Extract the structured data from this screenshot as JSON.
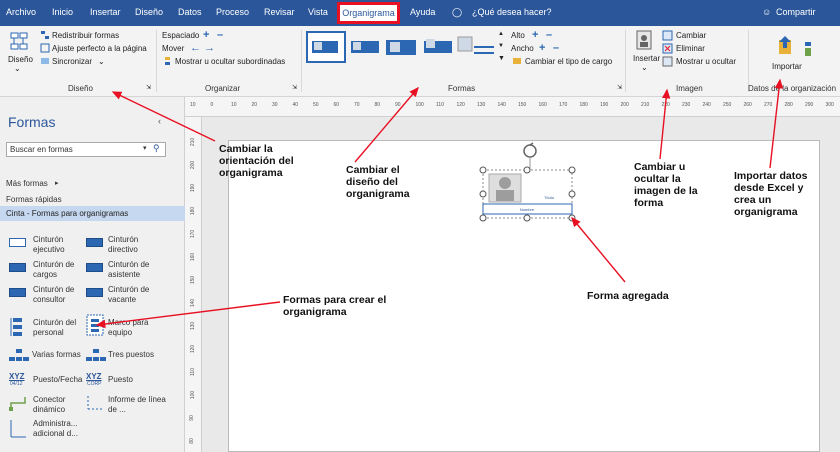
{
  "menu": {
    "items": [
      "Archivo",
      "Inicio",
      "Insertar",
      "Diseño",
      "Datos",
      "Proceso",
      "Revisar",
      "Vista"
    ],
    "active": "Organigrama",
    "help": "Ayuda",
    "tell_me": "¿Qué desea hacer?",
    "share": "Compartir"
  },
  "ribbon": {
    "diseno": {
      "big_label": "Diseño",
      "redistribuir": "Redistribuir formas",
      "ajuste": "Ajuste perfecto a la página",
      "sincronizar": "Sincronizar",
      "group": "Diseño"
    },
    "organizar": {
      "espaciado": "Espaciado",
      "mover": "Mover",
      "mostrar_ocultar": "Mostrar u ocultar subordinadas",
      "group": "Organizar"
    },
    "formas": {
      "alto": "Alto",
      "ancho": "Ancho",
      "cambiar_tipo": "Cambiar el tipo de cargo",
      "group": "Formas"
    },
    "imagen": {
      "insertar": "Insertar",
      "cambiar": "Cambiar",
      "eliminar": "Eliminar",
      "mostrar_ocultar": "Mostrar u ocultar",
      "group": "Imagen"
    },
    "datos": {
      "importar": "Importar",
      "group": "Datos de la organización"
    }
  },
  "shapes_panel": {
    "title": "Formas",
    "search_placeholder": "Buscar en formas",
    "mas_formas": "Más formas",
    "formas_rapidas": "Formas rápidas",
    "stencil": "Cinta - Formas para organigramas",
    "items": [
      [
        "Cinturón ejecutivo",
        "Cinturón directivo"
      ],
      [
        "Cinturón de cargos",
        "Cinturón de asistente"
      ],
      [
        "Cinturón de consultor",
        "Cinturón de vacante"
      ],
      [
        "Cinturón del personal",
        "Marco para equipo"
      ],
      [
        "Varias formas",
        "Tres puestos"
      ],
      [
        "Puesto/Fecha",
        "Puesto"
      ],
      [
        "Conector dinámico",
        "Informe de línea de ..."
      ],
      [
        "Administra... adicional d...",
        ""
      ]
    ],
    "xyz_badge": "XYZ",
    "xyz_sub_1": "04/12",
    "xyz_sub_2": "CORP"
  },
  "ruler": {
    "h_ticks": [
      "10",
      "0",
      "10",
      "20",
      "30",
      "40",
      "50",
      "60",
      "70",
      "80",
      "90",
      "100",
      "110",
      "120",
      "130",
      "140",
      "150",
      "160",
      "170",
      "180",
      "190",
      "200",
      "210",
      "220",
      "230",
      "240",
      "250",
      "260",
      "270",
      "280",
      "290",
      "300"
    ],
    "v_ticks": [
      "210",
      "200",
      "190",
      "180",
      "170",
      "160",
      "150",
      "140",
      "130",
      "120",
      "110",
      "100",
      "90",
      "80"
    ]
  },
  "org_shape": {
    "title": "Título",
    "name": "Nombre"
  },
  "annotations": {
    "orientacion": "Cambiar la orientación del organigrama",
    "diseno": "Cambiar el diseño del organigrama",
    "imagen": "Cambiar u ocultar la imagen de la forma",
    "importar": "Importar datos desde Excel y crea un organigrama",
    "formas_crear": "Formas para crear el organigrama",
    "forma_agregada": "Forma agregada"
  },
  "colors": {
    "menubar": "#2b579a",
    "accent_red": "#e81123",
    "shape_blue": "#2b67b2"
  }
}
